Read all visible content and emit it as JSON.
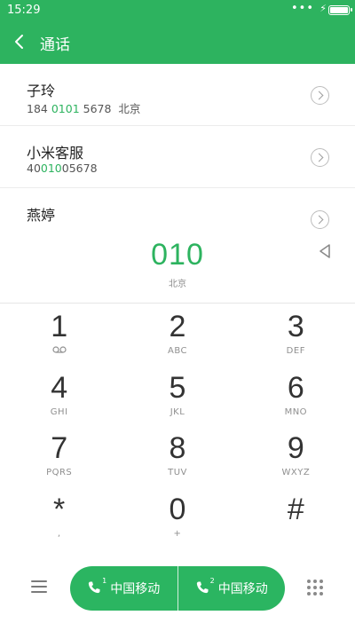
{
  "status_bar": {
    "time": "15:29",
    "dots": "•••",
    "battery_level": 1.0,
    "charging_icon": "bolt-icon"
  },
  "app_bar": {
    "title": "通话",
    "back_icon": "chevron-left-icon"
  },
  "contacts": [
    {
      "name": "子玲",
      "num_pre": "184 ",
      "num_hl": "0101",
      "num_post": " 5678  北京"
    },
    {
      "name": "小米客服",
      "num_pre": "40",
      "num_hl": "010",
      "num_post": "05678"
    },
    {
      "name": "燕婷",
      "num_pre": "",
      "num_hl": "",
      "num_post": ""
    }
  ],
  "dialer": {
    "number": "010",
    "location": "北京"
  },
  "keypad": [
    [
      {
        "digit": "1",
        "letters": ""
      },
      {
        "digit": "2",
        "letters": "ABC"
      },
      {
        "digit": "3",
        "letters": "DEF"
      }
    ],
    [
      {
        "digit": "4",
        "letters": "GHI"
      },
      {
        "digit": "5",
        "letters": "JKL"
      },
      {
        "digit": "6",
        "letters": "MNO"
      }
    ],
    [
      {
        "digit": "7",
        "letters": "PQRS"
      },
      {
        "digit": "8",
        "letters": "TUV"
      },
      {
        "digit": "9",
        "letters": "WXYZ"
      }
    ],
    [
      {
        "digit": "*",
        "letters": ","
      },
      {
        "digit": "0",
        "letters": "+"
      },
      {
        "digit": "#",
        "letters": ""
      }
    ]
  ],
  "call_buttons": [
    {
      "sim": "1",
      "label": "中国移动"
    },
    {
      "sim": "2",
      "label": "中国移动"
    }
  ],
  "colors": {
    "accent": "#2db35f",
    "call_green": "#2bb561"
  }
}
